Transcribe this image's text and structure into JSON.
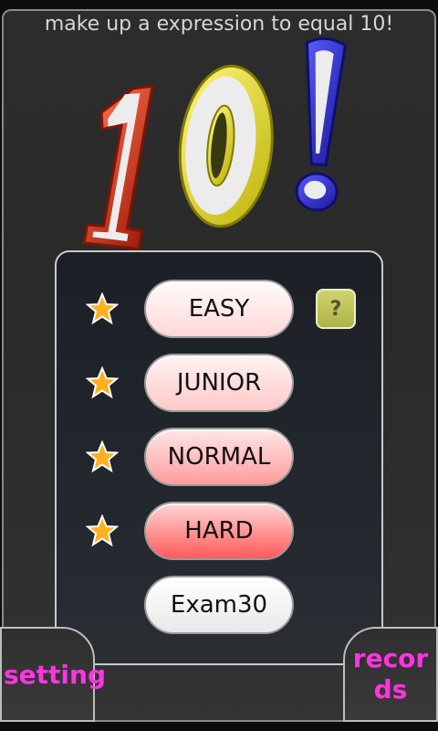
{
  "header": {
    "instruction": "make up a expression to equal 10!"
  },
  "logo": {
    "text": "10!"
  },
  "levels": [
    {
      "label": "EASY",
      "has_star": true,
      "gradient": [
        "#fffafa",
        "#ffd8d8"
      ]
    },
    {
      "label": "JUNIOR",
      "has_star": true,
      "gradient": [
        "#fff2f2",
        "#ffc9c9"
      ]
    },
    {
      "label": "NORMAL",
      "has_star": true,
      "gradient": [
        "#ffe6e6",
        "#ff9c9c"
      ]
    },
    {
      "label": "HARD",
      "has_star": true,
      "gradient": [
        "#ffd5d5",
        "#ff5a5a"
      ]
    },
    {
      "label": "Exam30",
      "has_star": false,
      "gradient": [
        "#ffffff",
        "#e9e9e9"
      ]
    }
  ],
  "help_button": {
    "label": "?"
  },
  "footer": {
    "setting_label": "setting",
    "records_label": "records"
  },
  "colors": {
    "accent_text": "#ff34e0",
    "logo_one": "#d8341a",
    "logo_zero": "#e2dc1c",
    "logo_bang": "#2727cc",
    "star": "#ffb020"
  },
  "icons": {
    "star": "star-icon",
    "help": "question-mark-icon"
  }
}
